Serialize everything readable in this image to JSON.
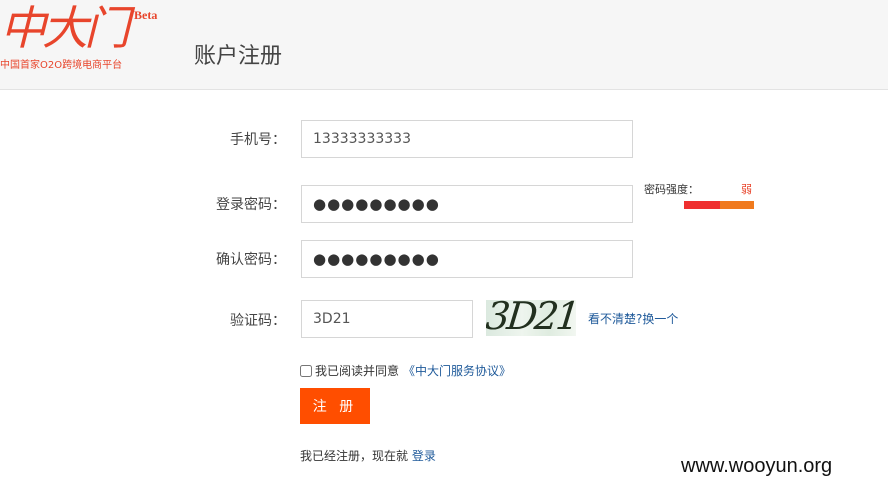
{
  "header": {
    "logo_glyphs": "中大门",
    "logo_beta": "Beta",
    "logo_slogan": "中国首家O2O跨境电商平台",
    "title": "账户注册"
  },
  "form": {
    "phone_label": "手机号：",
    "phone_value": "13333333333",
    "password_label": "登录密码：",
    "password_value": "●●●●●●●●●",
    "confirm_label": "确认密码：",
    "confirm_value": "●●●●●●●●●",
    "strength_label": "密码强度：",
    "strength_level": "弱",
    "strength_fraction": 0.5,
    "captcha_label": "验证码：",
    "captcha_value": "3D21",
    "captcha_image_text": "3D21",
    "captcha_refresh": "看不清楚?换一个",
    "agree_text": "我已阅读并同意",
    "agree_link": "《中大门服务协议》",
    "submit_label": "注 册",
    "login_prompt": "我已经注册，现在就",
    "login_link": "登录"
  },
  "watermark": "www.wooyun.org",
  "colors": {
    "brand": "#e8452c",
    "submit": "#ff4e00",
    "link": "#1f5a9a",
    "strength_weak": "#ef2f2f",
    "strength_mid": "#f07a1e"
  }
}
